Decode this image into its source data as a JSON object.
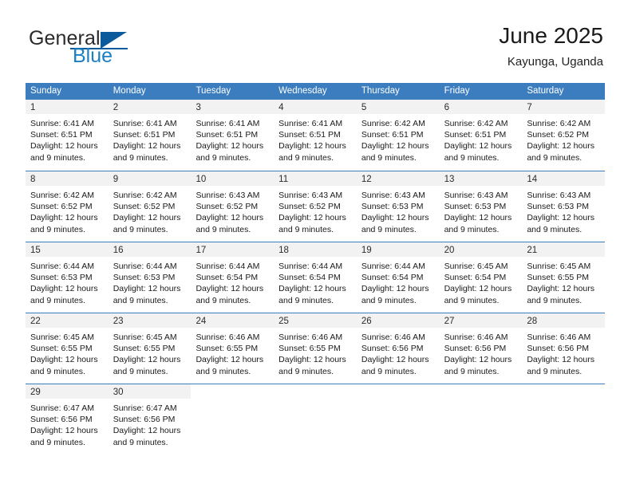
{
  "brand": {
    "general": "General",
    "blue": "Blue",
    "flag_icon": "triangle-flag-icon"
  },
  "header": {
    "title": "June 2025",
    "location": "Kayunga, Uganda"
  },
  "calendar": {
    "accent_color": "#3b7dbf",
    "daynum_band_color": "#f2f2f2",
    "weekdays": [
      "Sunday",
      "Monday",
      "Tuesday",
      "Wednesday",
      "Thursday",
      "Friday",
      "Saturday"
    ],
    "weeks": [
      [
        {
          "day": "1",
          "sunrise": "Sunrise: 6:41 AM",
          "sunset": "Sunset: 6:51 PM",
          "daylight1": "Daylight: 12 hours",
          "daylight2": "and 9 minutes."
        },
        {
          "day": "2",
          "sunrise": "Sunrise: 6:41 AM",
          "sunset": "Sunset: 6:51 PM",
          "daylight1": "Daylight: 12 hours",
          "daylight2": "and 9 minutes."
        },
        {
          "day": "3",
          "sunrise": "Sunrise: 6:41 AM",
          "sunset": "Sunset: 6:51 PM",
          "daylight1": "Daylight: 12 hours",
          "daylight2": "and 9 minutes."
        },
        {
          "day": "4",
          "sunrise": "Sunrise: 6:41 AM",
          "sunset": "Sunset: 6:51 PM",
          "daylight1": "Daylight: 12 hours",
          "daylight2": "and 9 minutes."
        },
        {
          "day": "5",
          "sunrise": "Sunrise: 6:42 AM",
          "sunset": "Sunset: 6:51 PM",
          "daylight1": "Daylight: 12 hours",
          "daylight2": "and 9 minutes."
        },
        {
          "day": "6",
          "sunrise": "Sunrise: 6:42 AM",
          "sunset": "Sunset: 6:51 PM",
          "daylight1": "Daylight: 12 hours",
          "daylight2": "and 9 minutes."
        },
        {
          "day": "7",
          "sunrise": "Sunrise: 6:42 AM",
          "sunset": "Sunset: 6:52 PM",
          "daylight1": "Daylight: 12 hours",
          "daylight2": "and 9 minutes."
        }
      ],
      [
        {
          "day": "8",
          "sunrise": "Sunrise: 6:42 AM",
          "sunset": "Sunset: 6:52 PM",
          "daylight1": "Daylight: 12 hours",
          "daylight2": "and 9 minutes."
        },
        {
          "day": "9",
          "sunrise": "Sunrise: 6:42 AM",
          "sunset": "Sunset: 6:52 PM",
          "daylight1": "Daylight: 12 hours",
          "daylight2": "and 9 minutes."
        },
        {
          "day": "10",
          "sunrise": "Sunrise: 6:43 AM",
          "sunset": "Sunset: 6:52 PM",
          "daylight1": "Daylight: 12 hours",
          "daylight2": "and 9 minutes."
        },
        {
          "day": "11",
          "sunrise": "Sunrise: 6:43 AM",
          "sunset": "Sunset: 6:52 PM",
          "daylight1": "Daylight: 12 hours",
          "daylight2": "and 9 minutes."
        },
        {
          "day": "12",
          "sunrise": "Sunrise: 6:43 AM",
          "sunset": "Sunset: 6:53 PM",
          "daylight1": "Daylight: 12 hours",
          "daylight2": "and 9 minutes."
        },
        {
          "day": "13",
          "sunrise": "Sunrise: 6:43 AM",
          "sunset": "Sunset: 6:53 PM",
          "daylight1": "Daylight: 12 hours",
          "daylight2": "and 9 minutes."
        },
        {
          "day": "14",
          "sunrise": "Sunrise: 6:43 AM",
          "sunset": "Sunset: 6:53 PM",
          "daylight1": "Daylight: 12 hours",
          "daylight2": "and 9 minutes."
        }
      ],
      [
        {
          "day": "15",
          "sunrise": "Sunrise: 6:44 AM",
          "sunset": "Sunset: 6:53 PM",
          "daylight1": "Daylight: 12 hours",
          "daylight2": "and 9 minutes."
        },
        {
          "day": "16",
          "sunrise": "Sunrise: 6:44 AM",
          "sunset": "Sunset: 6:53 PM",
          "daylight1": "Daylight: 12 hours",
          "daylight2": "and 9 minutes."
        },
        {
          "day": "17",
          "sunrise": "Sunrise: 6:44 AM",
          "sunset": "Sunset: 6:54 PM",
          "daylight1": "Daylight: 12 hours",
          "daylight2": "and 9 minutes."
        },
        {
          "day": "18",
          "sunrise": "Sunrise: 6:44 AM",
          "sunset": "Sunset: 6:54 PM",
          "daylight1": "Daylight: 12 hours",
          "daylight2": "and 9 minutes."
        },
        {
          "day": "19",
          "sunrise": "Sunrise: 6:44 AM",
          "sunset": "Sunset: 6:54 PM",
          "daylight1": "Daylight: 12 hours",
          "daylight2": "and 9 minutes."
        },
        {
          "day": "20",
          "sunrise": "Sunrise: 6:45 AM",
          "sunset": "Sunset: 6:54 PM",
          "daylight1": "Daylight: 12 hours",
          "daylight2": "and 9 minutes."
        },
        {
          "day": "21",
          "sunrise": "Sunrise: 6:45 AM",
          "sunset": "Sunset: 6:55 PM",
          "daylight1": "Daylight: 12 hours",
          "daylight2": "and 9 minutes."
        }
      ],
      [
        {
          "day": "22",
          "sunrise": "Sunrise: 6:45 AM",
          "sunset": "Sunset: 6:55 PM",
          "daylight1": "Daylight: 12 hours",
          "daylight2": "and 9 minutes."
        },
        {
          "day": "23",
          "sunrise": "Sunrise: 6:45 AM",
          "sunset": "Sunset: 6:55 PM",
          "daylight1": "Daylight: 12 hours",
          "daylight2": "and 9 minutes."
        },
        {
          "day": "24",
          "sunrise": "Sunrise: 6:46 AM",
          "sunset": "Sunset: 6:55 PM",
          "daylight1": "Daylight: 12 hours",
          "daylight2": "and 9 minutes."
        },
        {
          "day": "25",
          "sunrise": "Sunrise: 6:46 AM",
          "sunset": "Sunset: 6:55 PM",
          "daylight1": "Daylight: 12 hours",
          "daylight2": "and 9 minutes."
        },
        {
          "day": "26",
          "sunrise": "Sunrise: 6:46 AM",
          "sunset": "Sunset: 6:56 PM",
          "daylight1": "Daylight: 12 hours",
          "daylight2": "and 9 minutes."
        },
        {
          "day": "27",
          "sunrise": "Sunrise: 6:46 AM",
          "sunset": "Sunset: 6:56 PM",
          "daylight1": "Daylight: 12 hours",
          "daylight2": "and 9 minutes."
        },
        {
          "day": "28",
          "sunrise": "Sunrise: 6:46 AM",
          "sunset": "Sunset: 6:56 PM",
          "daylight1": "Daylight: 12 hours",
          "daylight2": "and 9 minutes."
        }
      ],
      [
        {
          "day": "29",
          "sunrise": "Sunrise: 6:47 AM",
          "sunset": "Sunset: 6:56 PM",
          "daylight1": "Daylight: 12 hours",
          "daylight2": "and 9 minutes."
        },
        {
          "day": "30",
          "sunrise": "Sunrise: 6:47 AM",
          "sunset": "Sunset: 6:56 PM",
          "daylight1": "Daylight: 12 hours",
          "daylight2": "and 9 minutes."
        },
        {
          "day": "",
          "sunrise": "",
          "sunset": "",
          "daylight1": "",
          "daylight2": ""
        },
        {
          "day": "",
          "sunrise": "",
          "sunset": "",
          "daylight1": "",
          "daylight2": ""
        },
        {
          "day": "",
          "sunrise": "",
          "sunset": "",
          "daylight1": "",
          "daylight2": ""
        },
        {
          "day": "",
          "sunrise": "",
          "sunset": "",
          "daylight1": "",
          "daylight2": ""
        },
        {
          "day": "",
          "sunrise": "",
          "sunset": "",
          "daylight1": "",
          "daylight2": ""
        }
      ]
    ]
  }
}
